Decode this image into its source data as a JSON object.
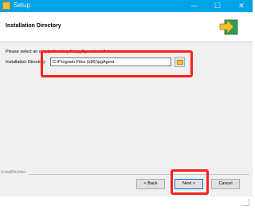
{
  "window": {
    "title": "Setup",
    "minimize_glyph": "—",
    "maximize_glyph": "☐",
    "close_glyph": "✕",
    "titlebar_color": "#00a2e8"
  },
  "header": {
    "title": "Installation Directory",
    "icon": "install-arrow-icon"
  },
  "content": {
    "instruction": "Please select an empty directory for pgAgent installation",
    "field_label": "Installation Directory",
    "directory_value": "C:\\Program Files (x86)\\pgAgent",
    "browse_icon": "folder-icon"
  },
  "footer": {
    "brand": "InstallBuilder",
    "back_label": "< Back",
    "next_label": "Next >",
    "cancel_label": "Cancel"
  },
  "annotations": {
    "highlight_color": "#ff1e1e"
  }
}
